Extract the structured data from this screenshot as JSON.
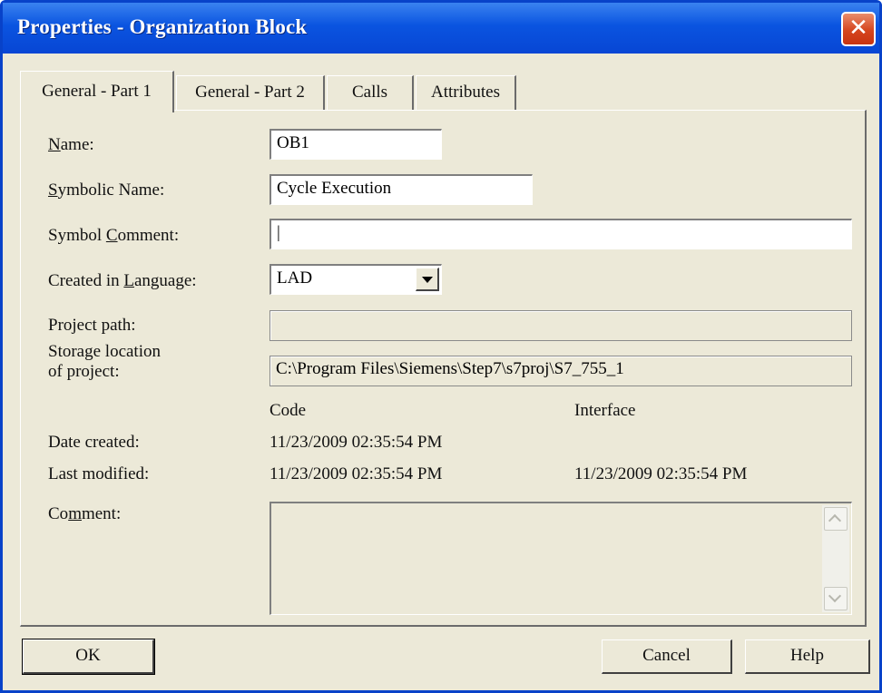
{
  "window": {
    "title": "Properties - Organization Block"
  },
  "tabs": [
    {
      "label": "General - Part 1",
      "active": true
    },
    {
      "label": "General - Part 2",
      "active": false
    },
    {
      "label": "Calls",
      "active": false
    },
    {
      "label": "Attributes",
      "active": false
    }
  ],
  "fields": {
    "name": {
      "pre": "",
      "ul": "N",
      "post": "ame:",
      "value": "OB1"
    },
    "symbolic_name": {
      "pre": "",
      "ul": "S",
      "post": "ymbolic Name:",
      "value": "Cycle Execution"
    },
    "symbol_comment": {
      "pre": "Symbol ",
      "ul": "C",
      "post": "omment:",
      "value": "|"
    },
    "language": {
      "pre": "Created in ",
      "ul": "L",
      "post": "anguage:",
      "value": "LAD"
    },
    "project_path": {
      "label": "Project path:",
      "value": ""
    },
    "storage": {
      "label_line1": "Storage location",
      "label_line2": "of project:",
      "value": "C:\\Program Files\\Siemens\\Step7\\s7proj\\S7_755_1"
    }
  },
  "dates": {
    "col_code": "Code",
    "col_interface": "Interface",
    "created_label": "Date created:",
    "created_code": "11/23/2009 02:35:54 PM",
    "modified_label": "Last modified:",
    "modified_code": "11/23/2009 02:35:54 PM",
    "modified_interface": "11/23/2009 02:35:54 PM"
  },
  "comment": {
    "pre": "Co",
    "ul": "m",
    "post": "ment:",
    "value": ""
  },
  "buttons": {
    "ok": "OK",
    "cancel": "Cancel",
    "help": "Help"
  }
}
